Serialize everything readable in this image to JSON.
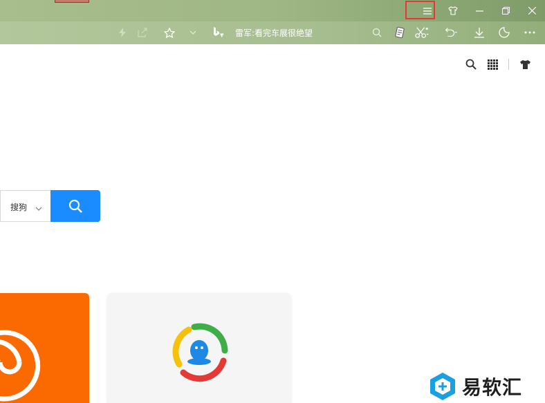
{
  "window": {
    "menu_icon": "hamburger-menu-icon",
    "skin_icon": "tshirt-skin-icon",
    "minimize_icon": "minimize-icon",
    "restore_icon": "restore-icon",
    "close_icon": "close-icon",
    "titlebar_colors": [
      "#a8be8c",
      "#7f9c68"
    ],
    "highlight_color": "#e53935"
  },
  "toolbar": {
    "icons": [
      "lightning-icon",
      "share-icon",
      "star-icon",
      "chevron-down-icon",
      "bing-icon",
      "search-icon",
      "notes-icon",
      "scissors-icon",
      "undo-icon",
      "download-icon",
      "night-mode-icon",
      "more-icon"
    ],
    "address_text": "雷军:看完车展很绝望"
  },
  "page": {
    "top_icons": [
      "search-icon",
      "apps-grid-icon",
      "tshirt-skin-icon"
    ],
    "search": {
      "engine_label": "搜狗",
      "button_color": "#1a8cff"
    },
    "tiles": [
      {
        "name": "sohu-tile",
        "color": "#fb6a00"
      },
      {
        "name": "tencent-news-tile",
        "color": "#f5f5f5"
      }
    ]
  },
  "watermark": {
    "text": "易软汇"
  }
}
